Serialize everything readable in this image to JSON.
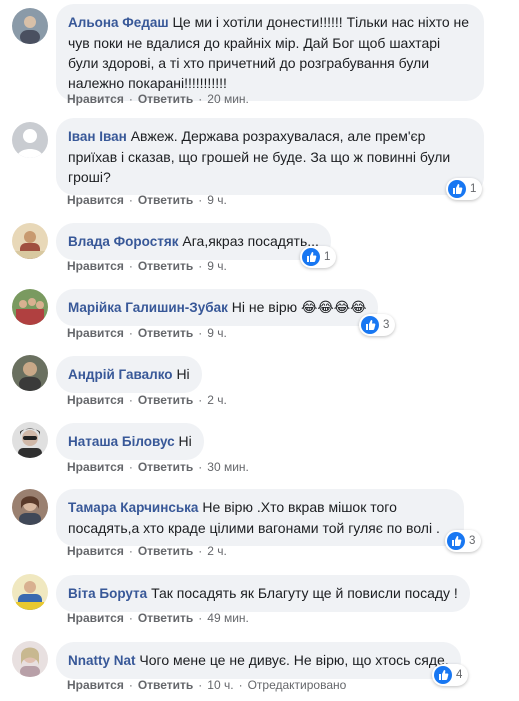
{
  "action_labels": {
    "like": "Нравится",
    "reply": "Ответить"
  },
  "comments": [
    {
      "author": "Альона Федаш",
      "text": "Це ми і хотіли донести!!!!!! Тільки нас ніхто не чув поки не вдалися до крайніх мір. Дай Бог щоб шахтарі були здорові, а ті хто причетний до розграбування були належно покарані!!!!!!!!!!!",
      "time": "20 мин.",
      "reactions": "",
      "avatar_color": "#8a9aa8"
    },
    {
      "author": "Іван Іван",
      "text": "Авжеж. Держава розрахувалася, але прем'єр приїхав і сказав, що грошей не буде. За що ж повинні були гроші?",
      "time": "9 ч.",
      "reactions": "1",
      "avatar_color": "#c9ccd1"
    },
    {
      "author": "Влада Форостяк",
      "text": "Ага,якраз посадять...",
      "time": "9 ч.",
      "reactions": "1",
      "avatar_color": "#b88a5a"
    },
    {
      "author": "Марійка Галишин-Зубак",
      "text": "Ні не вірю",
      "emoji": "😂😂😂😂",
      "time": "9 ч.",
      "reactions": "3",
      "avatar_color": "#6a8c5a"
    },
    {
      "author": "Андрій Гавалко",
      "text": "Ні",
      "time": "2 ч.",
      "reactions": "",
      "avatar_color": "#7a6a50"
    },
    {
      "author": "Наташа Біловус",
      "text": "Ні",
      "time": "30 мин.",
      "reactions": "",
      "avatar_color": "#5a5a60"
    },
    {
      "author": "Тамара Карчинська",
      "text": "Не вірю .Хто вкрав мішок того посадять,а хто краде цілими вагонами той гуляє по волі .",
      "time": "2 ч.",
      "reactions": "3",
      "avatar_color": "#8a7060"
    },
    {
      "author": "Віта Борута",
      "text": "Так посадять як Благуту ще й повисли посаду !",
      "time": "49 мин.",
      "reactions": "",
      "avatar_color": "#4a7aa0"
    },
    {
      "author": "Nnatty Nat",
      "text": "Чого мене це не дивує. Не вірю, що хтось сяде.",
      "time": "10 ч.",
      "edited": "Отредактировано",
      "reactions": "4",
      "avatar_color": "#b0a0a0"
    }
  ]
}
